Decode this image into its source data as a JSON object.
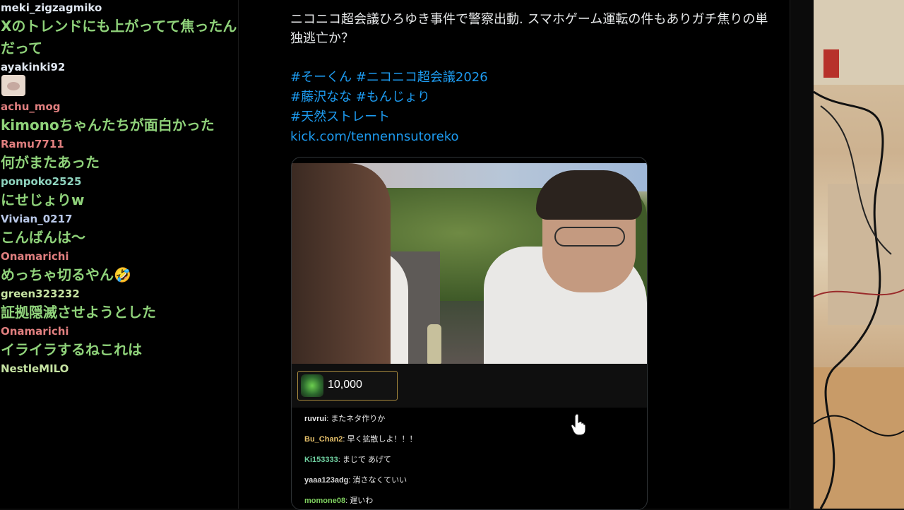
{
  "chat": {
    "messages": [
      {
        "user": "meki_zigzagmiko",
        "color": "#dfe6ef",
        "text": "Xのトレンドにも上がってて焦ったんだって"
      },
      {
        "user": "ayakinki92",
        "color": "#dfe6ef",
        "text": "",
        "emote": "cat-emote"
      },
      {
        "user": "achu_mog",
        "color": "#e07f7f",
        "text": "kimonoちゃんたちが面白かった"
      },
      {
        "user": "Ramu7711",
        "color": "#e07f7f",
        "text": "何がまたあった"
      },
      {
        "user": "ponpoko2525",
        "color": "#8fd4bf",
        "text": "にせじょりw"
      },
      {
        "user": "Vivian_0217",
        "color": "#b9c8e8",
        "text": "こんばんは〜"
      },
      {
        "user": "Onamarichi",
        "color": "#e07f7f",
        "text": "めっちゃ切るやん🤣"
      },
      {
        "user": "green323232",
        "color": "#c7e4a3",
        "text": "証拠隠滅させようとした"
      },
      {
        "user": "Onamarichi",
        "color": "#e07f7f",
        "text": "イライラするねこれは"
      },
      {
        "user": "NestleMILO",
        "color": "#c7e4a3",
        "text": ""
      }
    ]
  },
  "tweet": {
    "text": "ニコニコ超会議ひろゆき事件で警察出動. スマホゲーム運転の件もありガチ焦りの単独逃亡か？",
    "hashtag_lines": [
      "#そーくん #ニコニコ超会議2026",
      "#藤沢なな #もんじょり",
      "#天然ストレート"
    ],
    "link": "kick.com/tennennsutoreko"
  },
  "media": {
    "gift_amount": "10,000",
    "inner_chat": [
      {
        "name": "ruvrui",
        "name_color": "#e6e6e6",
        "text": "またネタ作りか"
      },
      {
        "name": "Bu_Chan2",
        "name_color": "#e8c26b",
        "text": "早く拡散しよ！！！"
      },
      {
        "name": "Ki153333",
        "name_color": "#6fd0a0",
        "text": "まじで あげて"
      },
      {
        "name": "yaaa123adg",
        "name_color": "#d9d9d9",
        "text": "消さなくていい"
      },
      {
        "name": "momone08",
        "name_color": "#7fd05f",
        "text": "遅いわ"
      }
    ]
  }
}
